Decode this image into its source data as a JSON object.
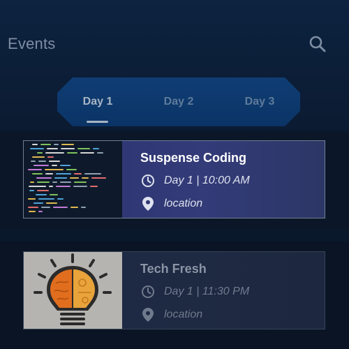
{
  "header": {
    "title": "Events",
    "search_icon": "search-icon"
  },
  "tabs": [
    {
      "label": "Day 1",
      "active": true
    },
    {
      "label": "Day 2",
      "active": false
    },
    {
      "label": "Day 3",
      "active": false
    }
  ],
  "events": [
    {
      "title": "Suspense Coding",
      "time": "Day 1 | 10:00 AM",
      "location": "location",
      "thumbnail": "code-screen-image"
    },
    {
      "title": "Tech Fresh",
      "time": "Day 1 | 11:30 PM",
      "location": "location",
      "thumbnail": "lightbulb-brain-image"
    }
  ],
  "colors": {
    "background": "#0b1a30",
    "tab_bar": "#0f3d74",
    "active_card": "#2f3874",
    "inactive_card": "#1f2a45"
  }
}
